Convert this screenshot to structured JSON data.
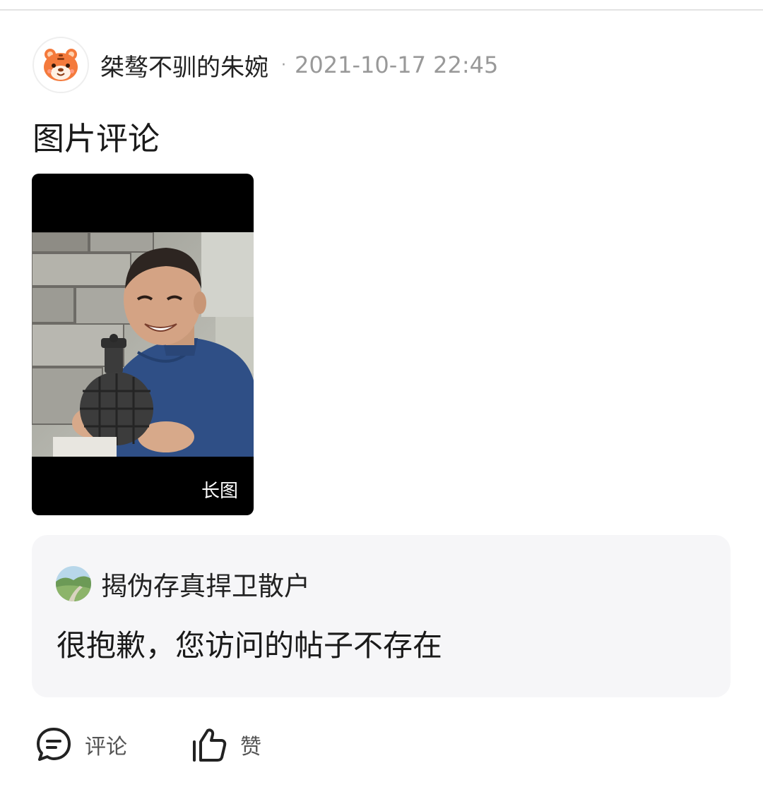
{
  "post": {
    "username": "桀骜不驯的朱婉",
    "separator": "·",
    "timestamp": "2021-10-17 22:45",
    "title": "图片评论",
    "image_badge": "长图"
  },
  "quote": {
    "username": "揭伪存真捍卫散户",
    "text": "很抱歉，您访问的帖子不存在"
  },
  "actions": {
    "comment_label": "评论",
    "like_label": "赞"
  },
  "icons": {
    "avatar": "tiger-face-icon",
    "quote_avatar": "landscape-avatar-icon",
    "comment": "comment-bubble-icon",
    "like": "thumbs-up-icon"
  },
  "colors": {
    "text_primary": "#222222",
    "text_secondary": "#999999",
    "quote_background": "#f6f6f8",
    "tiger": "#f47a3c"
  }
}
